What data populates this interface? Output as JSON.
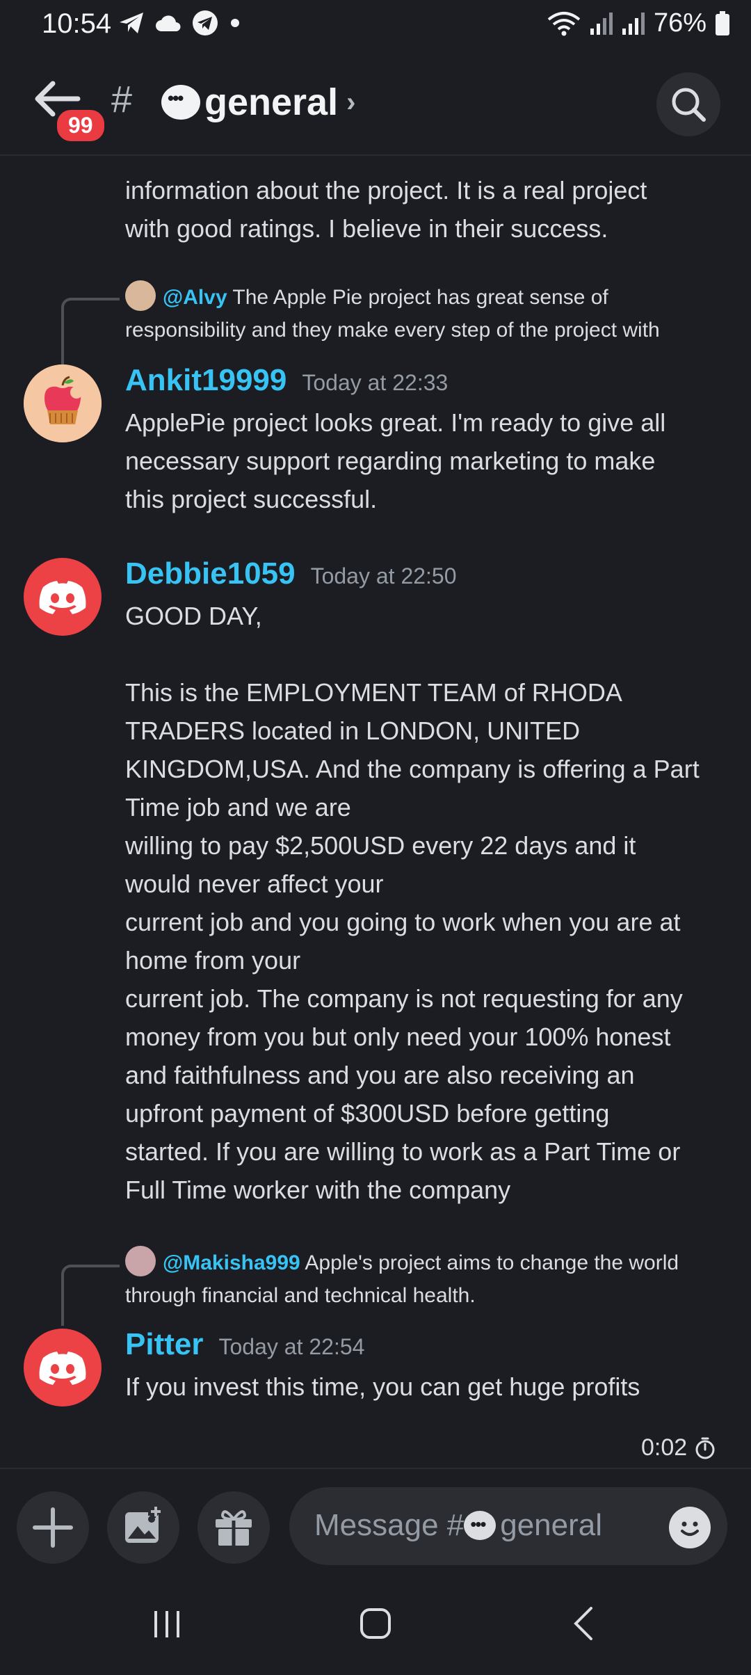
{
  "status_bar": {
    "time": "10:54",
    "battery": "76%"
  },
  "header": {
    "unread_badge": "99",
    "channel_name": "general"
  },
  "messages": {
    "partial_text": "promising team. I feel love after reading information about the project. It is a real project with good ratings. I believe in their success.",
    "partial_lines": [
      "information about the project. It is a real project",
      "with good ratings. I believe in their success."
    ],
    "reply1": {
      "mention": "@Alvy",
      "text_line1": "The Apple Pie project has great sense of",
      "text_line2": "responsibility and they make every step of the project with"
    },
    "msg1": {
      "username": "Ankit19999",
      "timestamp": "Today at 22:33",
      "lines": [
        "ApplePie project looks great. I'm ready to give all",
        "necessary support regarding marketing to make",
        "this project successful."
      ]
    },
    "msg2": {
      "username": "Debbie1059",
      "timestamp": "Today at 22:50",
      "lines": [
        "GOOD DAY,",
        "",
        "This is the EMPLOYMENT TEAM of RHODA",
        "TRADERS located in LONDON, UNITED",
        "KINGDOM,USA. And the company is offering a Part",
        "Time job and we are",
        "willing to pay $2,500USD every 22 days and it",
        "would never affect your",
        "current job and you going to work when you are at",
        "home from your",
        "current job. The company is not requesting for any",
        "money from you but only need your 100% honest",
        "and faithfulness and you are also receiving an",
        "upfront payment of $300USD before getting",
        "started. If you are willing to work as a Part Time or",
        "Full Time worker with the company"
      ]
    },
    "reply2": {
      "mention": "@Makisha999",
      "text_line1": "Apple's project aims to change the world",
      "text_line2": "through financial and technical health."
    },
    "msg3": {
      "username": "Pitter",
      "timestamp": "Today at 22:54",
      "lines": [
        "If you invest this time, you can get huge profits"
      ]
    },
    "slowmode_timer": "0:02"
  },
  "composer": {
    "placeholder_prefix": "Message #",
    "placeholder_channel": "general"
  },
  "icons": [
    "telegram-icon",
    "cloud-icon",
    "wifi-icon",
    "signal-icon",
    "battery-icon",
    "back-arrow-icon",
    "search-icon",
    "plus-icon",
    "image-icon",
    "gift-icon",
    "emoji-icon",
    "timer-icon",
    "discord-logo-icon"
  ]
}
